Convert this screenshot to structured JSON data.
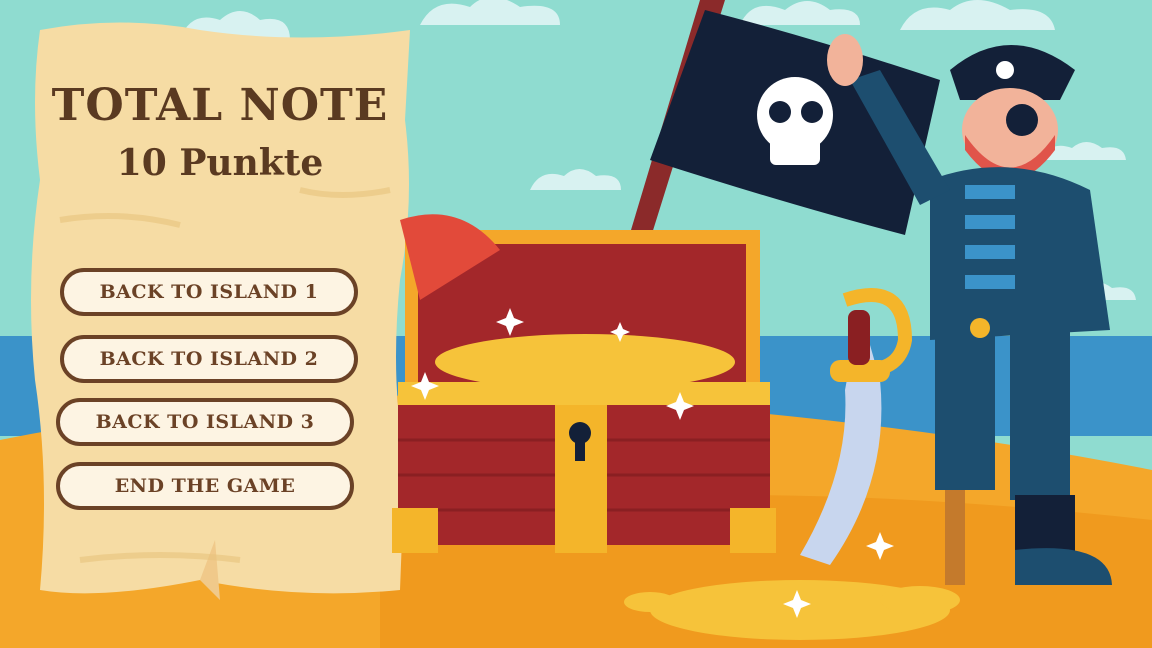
{
  "score": {
    "title": "TOTAL NOTE",
    "value": "10 Punkte"
  },
  "menu": {
    "buttons": [
      {
        "label": "BACK TO ISLAND 1"
      },
      {
        "label": "BACK TO ISLAND 2"
      },
      {
        "label": "BACK TO ISLAND 3"
      },
      {
        "label": "END THE GAME"
      }
    ]
  },
  "colors": {
    "sky": "#8fdcd0",
    "sea": "#3b93c9",
    "sand": "#f4a72a",
    "parchment": "#f6dca4",
    "button_border": "#6b4226",
    "button_fill": "#fdf4e3",
    "text": "#5a3a21"
  },
  "icons": [
    "skull-crossbones-icon",
    "keyhole-icon",
    "sparkle-icon"
  ]
}
